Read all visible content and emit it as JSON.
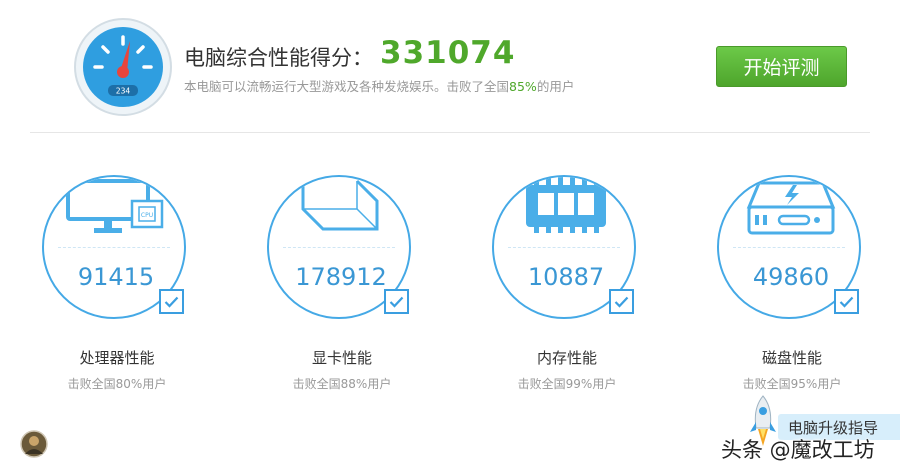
{
  "header": {
    "title": "电脑综合性能得分：",
    "score": "331074",
    "desc_before": "本电脑可以流畅运行大型游戏及各种发烧娱乐。击败了全国",
    "desc_pct": "85%",
    "desc_after": "的用户",
    "gauge_readout": "234",
    "start_button_label": "开始评测"
  },
  "colors": {
    "accent_green": "#4fa82b",
    "accent_blue": "#45a9e6"
  },
  "cards": [
    {
      "icon": "cpu-monitor-icon",
      "value": "91415",
      "title": "处理器性能",
      "sub": "击败全国80%用户"
    },
    {
      "icon": "graphics-card-icon",
      "value": "178912",
      "title": "显卡性能",
      "sub": "击败全国88%用户"
    },
    {
      "icon": "memory-module-icon",
      "value": "10887",
      "title": "内存性能",
      "sub": "击败全国99%用户"
    },
    {
      "icon": "disk-drive-icon",
      "value": "49860",
      "title": "磁盘性能",
      "sub": "击败全国95%用户"
    }
  ],
  "footer": {
    "upgrade_label": "电脑升级指导",
    "watermark": "头条 @魔改工坊"
  }
}
